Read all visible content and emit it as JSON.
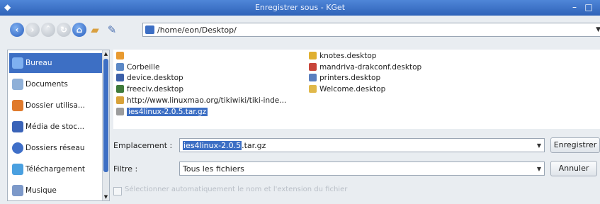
{
  "window": {
    "title": "Enregistrer sous - KGet",
    "minimize_glyph": "–",
    "maximize_glyph": "□"
  },
  "toolbar": {
    "path": "/home/eon/Desktop/",
    "icons": [
      "back-icon",
      "forward-icon",
      "up-icon",
      "reload-icon",
      "home-icon",
      "new-folder-icon",
      "settings-icon"
    ]
  },
  "sidebar": {
    "items": [
      {
        "label": "Bureau",
        "icon": "desktop-icon",
        "selected": true,
        "color": "#4a7fd0"
      },
      {
        "label": "Documents",
        "icon": "documents-icon",
        "selected": false,
        "color": "#8fb0d8"
      },
      {
        "label": "Dossier utilisa...",
        "icon": "home-folder-icon",
        "selected": false,
        "color": "#e07a2c"
      },
      {
        "label": "Média de stoc...",
        "icon": "storage-media-icon",
        "selected": false,
        "color": "#3a63b8"
      },
      {
        "label": "Dossiers réseau",
        "icon": "network-folder-icon",
        "selected": false,
        "color": "#3f6fc8"
      },
      {
        "label": "Téléchargement",
        "icon": "downloads-icon",
        "selected": false,
        "color": "#4aa0e0"
      },
      {
        "label": "Musique",
        "icon": "music-icon",
        "selected": false,
        "color": "#7d99c9"
      }
    ]
  },
  "files": {
    "left": [
      {
        "name": "",
        "icon": "folder-icon",
        "selected": false,
        "color": "#e89a30"
      },
      {
        "name": "Corbeille",
        "icon": "trash-icon",
        "selected": false,
        "color": "#5b88c6"
      },
      {
        "name": "device.desktop",
        "icon": "device-icon",
        "selected": false,
        "color": "#3b5fa8"
      },
      {
        "name": "freeciv.desktop",
        "icon": "freeciv-icon",
        "selected": false,
        "color": "#3f7a3a"
      },
      {
        "name": "http://www.linuxmao.org/tikiwiki/tiki-inde...",
        "icon": "web-icon",
        "selected": false,
        "color": "#d8a23a"
      },
      {
        "name": "ies4linux-2.0.5.tar.gz",
        "icon": "archive-icon",
        "selected": true,
        "color": "#9c9c9c"
      }
    ],
    "right": [
      {
        "name": "knotes.desktop",
        "icon": "knotes-icon",
        "selected": false,
        "color": "#e0b030"
      },
      {
        "name": "mandriva-drakconf.desktop",
        "icon": "drakconf-icon",
        "selected": false,
        "color": "#c8453a"
      },
      {
        "name": "printers.desktop",
        "icon": "printer-icon",
        "selected": false,
        "color": "#5a7fbf"
      },
      {
        "name": "Welcome.desktop",
        "icon": "welcome-icon",
        "selected": false,
        "color": "#e0b84a"
      }
    ]
  },
  "form": {
    "location_label": "Emplacement :",
    "location_selected": "ies4linux-2.0.5",
    "location_rest": ".tar.gz",
    "filter_label": "Filtre :",
    "filter_value": "Tous les fichiers",
    "save_button": "Enregistrer",
    "cancel_button": "Annuler",
    "auto_ext_label": "Sélectionner automatiquement le nom et l'extension du fichier",
    "auto_ext_checked": false
  },
  "colors": {
    "selection": "#3d6fc4",
    "titlebar": "#2f63b8"
  }
}
